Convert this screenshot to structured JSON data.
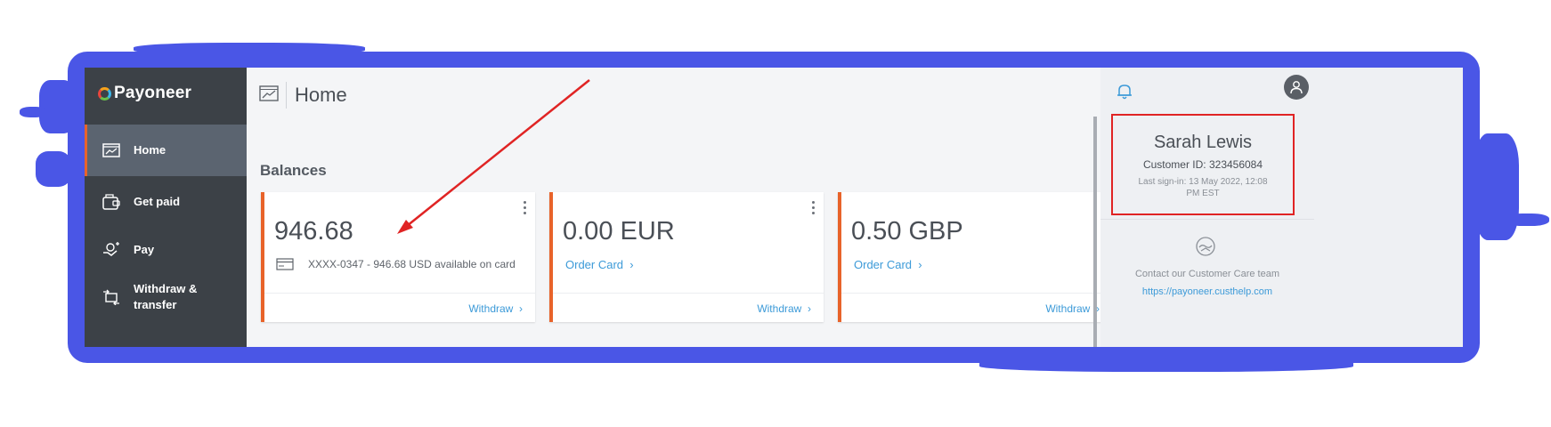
{
  "brand": {
    "name": "Payoneer"
  },
  "sidebar": {
    "items": [
      {
        "label": "Home",
        "icon": "chart-window-icon",
        "active": true
      },
      {
        "label": "Get paid",
        "icon": "wallet-icon",
        "active": false
      },
      {
        "label": "Pay",
        "icon": "pay-hand-icon",
        "active": false
      },
      {
        "label": "Withdraw & transfer",
        "icon": "transfer-icon",
        "active": false
      }
    ]
  },
  "header": {
    "title": "Home",
    "help_icon": "help-circle-icon"
  },
  "main": {
    "section_title": "Balances",
    "cards": [
      {
        "amount": "946.68",
        "card_info": "XXXX-0347 - 946.68 USD available on card",
        "action": "Withdraw"
      },
      {
        "amount": "0.00 EUR",
        "link": "Order Card",
        "action": "Withdraw"
      },
      {
        "amount": "0.50 GBP",
        "link": "Order Card",
        "action": "Withdraw"
      }
    ]
  },
  "right_panel": {
    "user_name": "Sarah Lewis",
    "customer_id": "Customer ID: 323456084",
    "last_signin": "Last sign-in: 13 May 2022, 12:08 PM EST",
    "care_text": "Contact our Customer Care team",
    "care_link": "https://payoneer.custhelp.com"
  },
  "colors": {
    "frame": "#4a56e6",
    "sidebar": "#3c4147",
    "accent": "#e8632a",
    "link": "#3c9ad8",
    "highlight": "#e02424"
  }
}
